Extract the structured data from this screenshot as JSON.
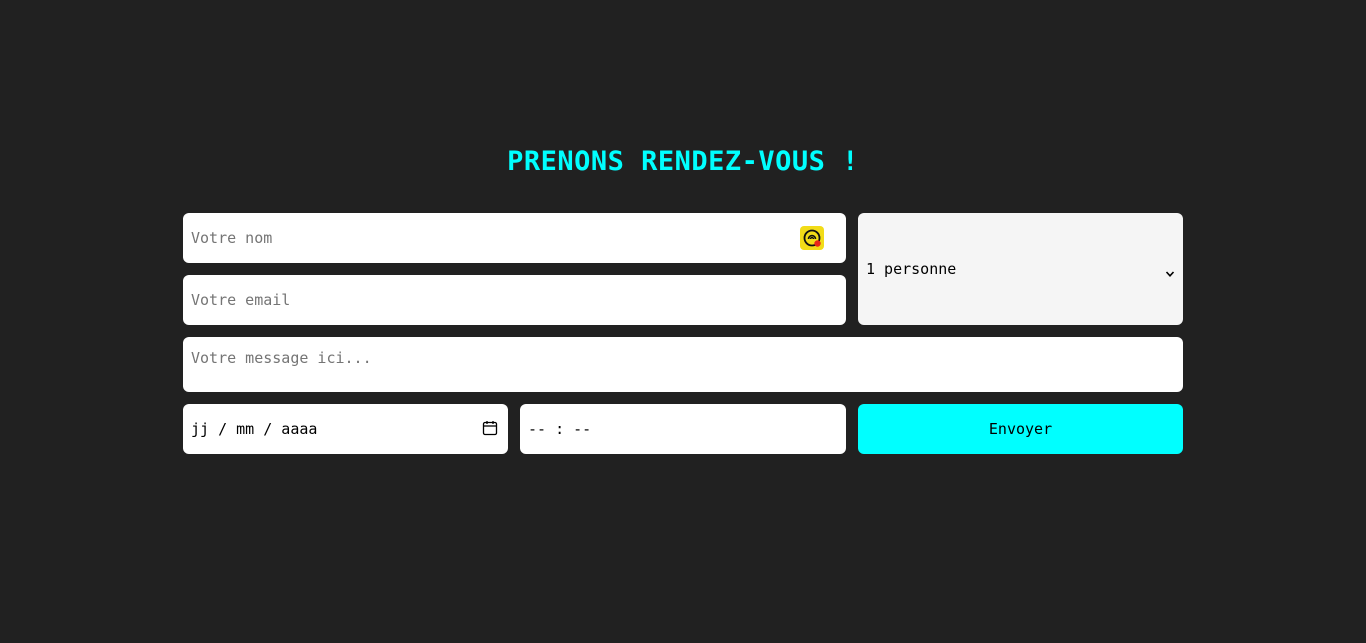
{
  "form": {
    "title": "PRENONS RENDEZ-VOUS !",
    "name_placeholder": "Votre nom",
    "email_placeholder": "Votre email",
    "message_placeholder": "Votre message ici...",
    "guests_selected": "1 personne",
    "date_placeholder": "jj / mm / aaaa",
    "time_placeholder": "-- : --",
    "submit_label": "Envoyer"
  },
  "icons": {
    "name_field_icon": "password-manager-icon",
    "date_icon": "calendar-icon",
    "select_icon": "chevron-down-icon"
  },
  "colors": {
    "background": "#212121",
    "accent": "#00ffff",
    "field": "#ffffff",
    "select_bg": "#f5f5f5"
  }
}
